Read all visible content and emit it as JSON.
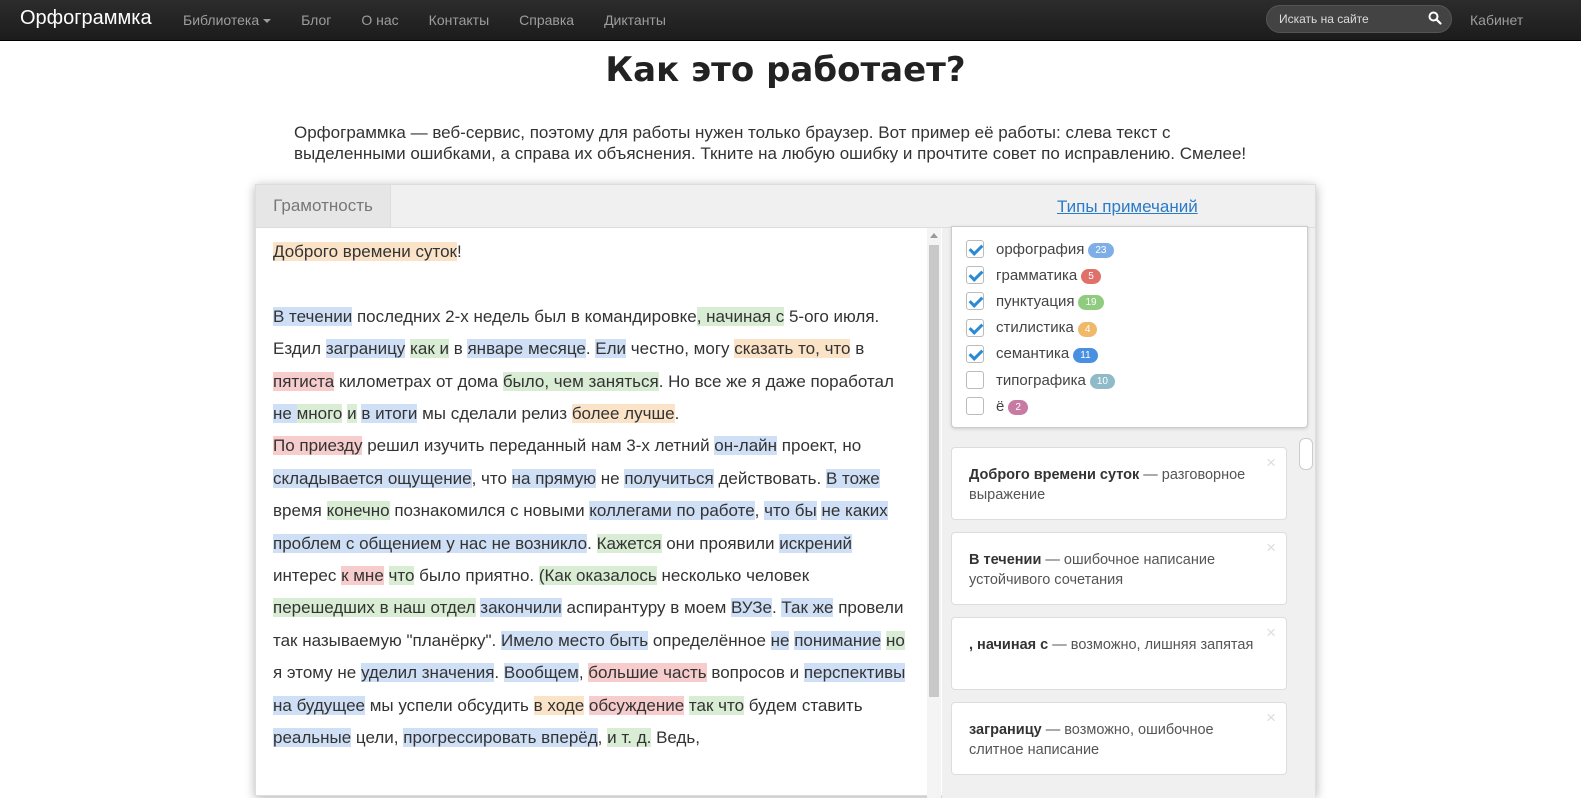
{
  "navbar": {
    "brand": "Орфограммка",
    "items": [
      {
        "label": "Библиотека",
        "dropdown": true
      },
      {
        "label": "Блог"
      },
      {
        "label": "О нас"
      },
      {
        "label": "Контакты"
      },
      {
        "label": "Справка"
      },
      {
        "label": "Диктанты"
      }
    ],
    "search_placeholder": "Искать на сайте",
    "cabinet": "Кабинет"
  },
  "page": {
    "title": "Как это работает?",
    "intro": "Орфограммка — веб-сервис, поэтому для работы нужен только браузер. Вот пример её работы: слева текст с выделенными ошибками, а справа их объяснения. Ткните на любую ошибку и прочтите совет по исправлению. Смелее!"
  },
  "widget": {
    "tab": "Грамотность",
    "types_link": "Типы примечаний",
    "paragraphs": [
      [
        {
          "t": "Доброго времени суток",
          "c": "o"
        },
        {
          "t": "!"
        }
      ],
      [
        {
          "t": "В течении",
          "c": "b"
        },
        {
          "t": " последних 2-х недель был в командировке"
        },
        {
          "t": ", начиная с",
          "c": "g"
        },
        {
          "t": " 5-ого июля. Ездил "
        },
        {
          "t": "заграницу",
          "c": "b"
        },
        {
          "t": " "
        },
        {
          "t": "как и",
          "c": "g"
        },
        {
          "t": " в "
        },
        {
          "t": "январе месяце",
          "c": "b"
        },
        {
          "t": ". "
        },
        {
          "t": "Ели",
          "c": "b"
        },
        {
          "t": " честно, могу "
        },
        {
          "t": "сказать то, что",
          "c": "o"
        },
        {
          "t": " в "
        },
        {
          "t": "пятиста",
          "c": "r"
        },
        {
          "t": " километрах от дома "
        },
        {
          "t": "было, чем заняться",
          "c": "g"
        },
        {
          "t": ". Но все же я даже поработал "
        },
        {
          "t": "не ",
          "c": "b"
        },
        {
          "t": "много",
          "c": "g"
        },
        {
          "t": " "
        },
        {
          "t": "и",
          "c": "g"
        },
        {
          "t": " "
        },
        {
          "t": "в итоги",
          "c": "b"
        },
        {
          "t": " мы сделали релиз "
        },
        {
          "t": "более лучше",
          "c": "o"
        },
        {
          "t": "."
        }
      ],
      [
        {
          "t": "По приезду",
          "c": "r"
        },
        {
          "t": " решил изучить переданный нам 3-х летний "
        },
        {
          "t": "он-лайн",
          "c": "b"
        },
        {
          "t": " проект, но "
        },
        {
          "t": "складывается ощущение",
          "c": "b"
        },
        {
          "t": ", что "
        },
        {
          "t": "на прямую",
          "c": "b"
        },
        {
          "t": " не "
        },
        {
          "t": "получиться",
          "c": "b"
        },
        {
          "t": " действовать. "
        },
        {
          "t": "В тоже",
          "c": "b"
        },
        {
          "t": " время "
        },
        {
          "t": "конечно",
          "c": "g"
        },
        {
          "t": " познакомился с новыми "
        },
        {
          "t": "коллегами по работе",
          "c": "b"
        },
        {
          "t": ", "
        },
        {
          "t": "что бы",
          "c": "b"
        },
        {
          "t": " "
        },
        {
          "t": "не каких",
          "c": "b"
        },
        {
          "t": " "
        },
        {
          "t": "проблем с общением у нас не возникло",
          "c": "b"
        },
        {
          "t": ". "
        },
        {
          "t": "Кажется",
          "c": "g"
        },
        {
          "t": " они проявили "
        },
        {
          "t": "искрений",
          "c": "b"
        },
        {
          "t": " интерес "
        },
        {
          "t": "к мне",
          "c": "r"
        },
        {
          "t": " "
        },
        {
          "t": "что",
          "c": "g"
        },
        {
          "t": " было приятно. "
        },
        {
          "t": "(",
          "c": "g"
        },
        {
          "t": "Как оказалось",
          "c": "g"
        },
        {
          "t": " несколько человек "
        },
        {
          "t": "перешедших в наш отдел",
          "c": "g"
        },
        {
          "t": " "
        },
        {
          "t": "закончили",
          "c": "b"
        },
        {
          "t": " аспирантуру в моем "
        },
        {
          "t": "ВУЗе",
          "c": "b"
        },
        {
          "t": ". "
        },
        {
          "t": "Так же",
          "c": "b"
        },
        {
          "t": " провели так называемую \"планёрку\". "
        },
        {
          "t": "Имело место быть",
          "c": "b"
        },
        {
          "t": " определённое "
        },
        {
          "t": "не",
          "c": "b"
        },
        {
          "t": " "
        },
        {
          "t": "понимание",
          "c": "b"
        },
        {
          "t": " "
        },
        {
          "t": "но",
          "c": "g"
        },
        {
          "t": " я этому не "
        },
        {
          "t": "уделил значения",
          "c": "b"
        },
        {
          "t": ". "
        },
        {
          "t": "Вообщем",
          "c": "b"
        },
        {
          "t": ", "
        },
        {
          "t": "большие часть",
          "c": "r"
        },
        {
          "t": " вопросов и "
        },
        {
          "t": "перспективы на будущее",
          "c": "b"
        },
        {
          "t": " мы успели обсудить "
        },
        {
          "t": "в ходе",
          "c": "o"
        },
        {
          "t": " "
        },
        {
          "t": "обсуждение",
          "c": "r"
        },
        {
          "t": " "
        },
        {
          "t": "так что",
          "c": "g"
        },
        {
          "t": " будем ставить "
        },
        {
          "t": "реальные",
          "c": "b"
        },
        {
          "t": " цели, "
        },
        {
          "t": "прогрессировать вперёд",
          "c": "b"
        },
        {
          "t": ", "
        },
        {
          "t": "и т. д.",
          "c": "g"
        },
        {
          "t": " Ведь, "
        }
      ]
    ],
    "types": [
      {
        "label": "орфография",
        "count": "23",
        "checked": true,
        "color": "#7eaee6"
      },
      {
        "label": "грамматика",
        "count": "5",
        "checked": true,
        "color": "#e0706a"
      },
      {
        "label": "пунктуация",
        "count": "19",
        "checked": true,
        "color": "#8fcc7f"
      },
      {
        "label": "стилистика",
        "count": "4",
        "checked": true,
        "color": "#f0b96a"
      },
      {
        "label": "семантика",
        "count": "11",
        "checked": true,
        "color": "#4a90e2"
      },
      {
        "label": "типографика",
        "count": "10",
        "checked": false,
        "color": "#8fbbc9"
      },
      {
        "label": "ё",
        "count": "2",
        "checked": false,
        "color": "#c77ba2"
      }
    ],
    "cards": [
      {
        "phrase": "Доброго времени суток",
        "explanation": "разговорное выражение"
      },
      {
        "phrase": "В течении",
        "explanation": "ошибочное написание устойчивого сочетания"
      },
      {
        "phrase": ", начиная с",
        "explanation": "возможно, лишняя запятая"
      },
      {
        "phrase": "заграницу",
        "explanation": "возможно, ошибочное слитное написание"
      }
    ],
    "close_glyph": "×"
  }
}
